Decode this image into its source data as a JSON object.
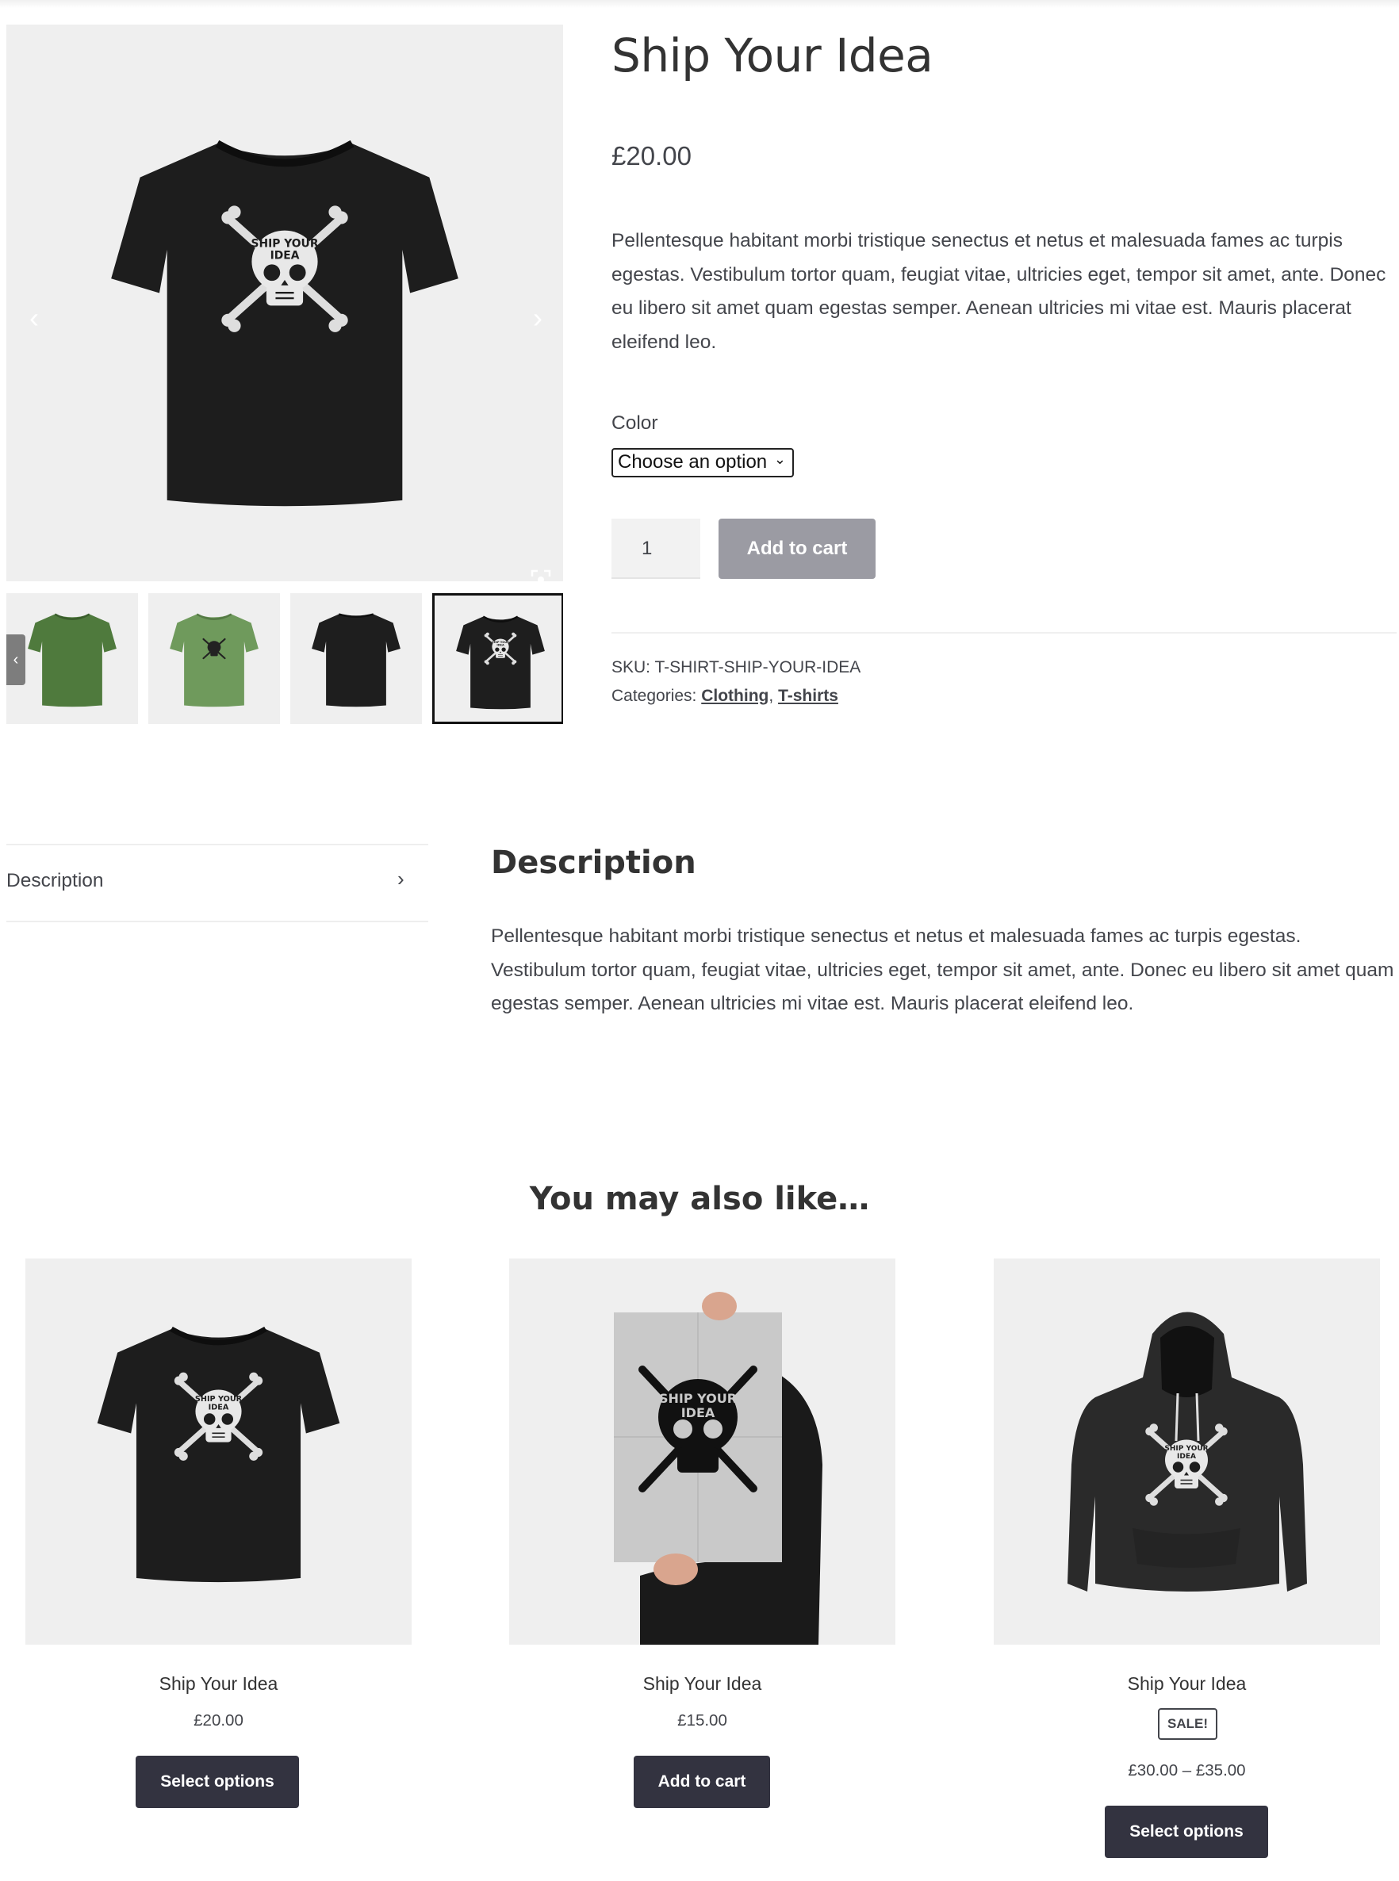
{
  "product": {
    "title": "Ship Your Idea",
    "price": "£20.00",
    "short_description": "Pellentesque habitant morbi tristique senectus et netus et malesuada fames ac turpis egestas. Vestibulum tortor quam, feugiat vitae, ultricies eget, tempor sit amet, ante. Donec eu libero sit amet quam egestas semper. Aenean ultricies mi vitae est. Mauris placerat eleifend leo.",
    "color_label": "Color",
    "color_select_value": "Choose an option",
    "quantity": "1",
    "add_to_cart_label": "Add to cart",
    "sku_label": "SKU:",
    "sku": "T-SHIRT-SHIP-YOUR-IDEA",
    "categories_label": "Categories:",
    "categories": [
      "Clothing",
      "T-shirts"
    ],
    "category_separator": ",",
    "print_text": "SHIP YOUR IDEA"
  },
  "gallery": {
    "prev_icon": "chevron-left-icon",
    "next_icon": "chevron-right-icon",
    "zoom_icon": "fullscreen-icon",
    "thumbnails": [
      {
        "name": "green-tshirt-front",
        "shirt_color": "#4f7a3d",
        "print": false
      },
      {
        "name": "green-tshirt-print",
        "shirt_color": "#6f9a5c",
        "print": true
      },
      {
        "name": "black-tshirt-back",
        "shirt_color": "#1e1e1e",
        "print": false
      },
      {
        "name": "black-tshirt-print",
        "shirt_color": "#1e1e1e",
        "print": true
      }
    ]
  },
  "tabs": {
    "items": [
      {
        "label": "Description",
        "icon": "chevron-right-icon"
      }
    ],
    "panel_title": "Description",
    "panel_text": "Pellentesque habitant morbi tristique senectus et netus et malesuada fames ac turpis egestas. Vestibulum tortor quam, feugiat vitae, ultricies eget, tempor sit amet, ante. Donec eu libero sit amet quam egestas semper. Aenean ultricies mi vitae est. Mauris placerat eleifend leo."
  },
  "related": {
    "title": "You may also like…",
    "products": [
      {
        "name": "Ship Your Idea",
        "price": "£20.00",
        "button": "Select options",
        "image": "black-tshirt"
      },
      {
        "name": "Ship Your Idea",
        "price": "£15.00",
        "button": "Add to cart",
        "image": "poster"
      },
      {
        "name": "Ship Your Idea",
        "badge": "SALE!",
        "price": "£30.00 – £35.00",
        "button": "Select options",
        "image": "black-hoodie"
      }
    ]
  },
  "colors": {
    "text": "#43454b",
    "heading": "#333333",
    "button_dark": "#333340",
    "button_disabled": "#9b9ba3",
    "image_bg": "#efefef"
  }
}
